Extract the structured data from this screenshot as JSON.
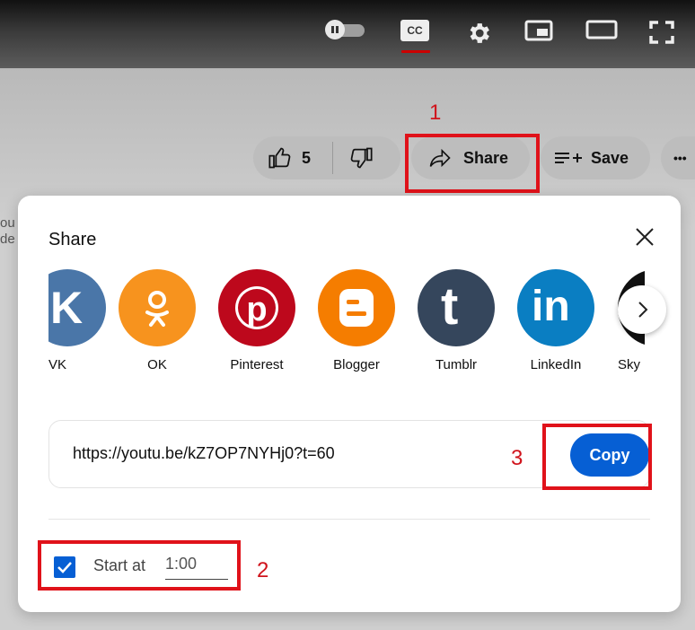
{
  "player": {
    "cc_label": "CC"
  },
  "actions": {
    "like_count": "5",
    "share_label": "Share",
    "save_label": "Save",
    "more_label": "•••"
  },
  "annotations": {
    "n1": "1",
    "n2": "2",
    "n3": "3",
    "color": "#e0121a"
  },
  "edge_text": {
    "line1": "ou",
    "line2": "de"
  },
  "dialog": {
    "title": "Share",
    "share_targets": [
      {
        "label": "VK",
        "color": "#4a76a8",
        "icon": "vk-icon",
        "glyph": "K"
      },
      {
        "label": "OK",
        "color": "#f7931e",
        "icon": "ok-icon",
        "glyph": "Ⓞ"
      },
      {
        "label": "Pinterest",
        "color": "#bd081c",
        "icon": "pinterest-icon",
        "glyph": "P"
      },
      {
        "label": "Blogger",
        "color": "#f57d00",
        "icon": "blogger-icon",
        "glyph": "B"
      },
      {
        "label": "Tumblr",
        "color": "#35465c",
        "icon": "tumblr-icon",
        "glyph": "t"
      },
      {
        "label": "LinkedIn",
        "color": "#0a7ec2",
        "icon": "linkedin-icon",
        "glyph": "in"
      },
      {
        "label": "Sky",
        "color": "#111111",
        "icon": "skyrock-icon",
        "glyph": ""
      }
    ],
    "url": "https://youtu.be/kZ7OP7NYHj0?t=60",
    "copy_label": "Copy",
    "start_at_label": "Start at",
    "start_at_value": "1:00",
    "start_at_checked": true,
    "accent": "#065fd4"
  }
}
